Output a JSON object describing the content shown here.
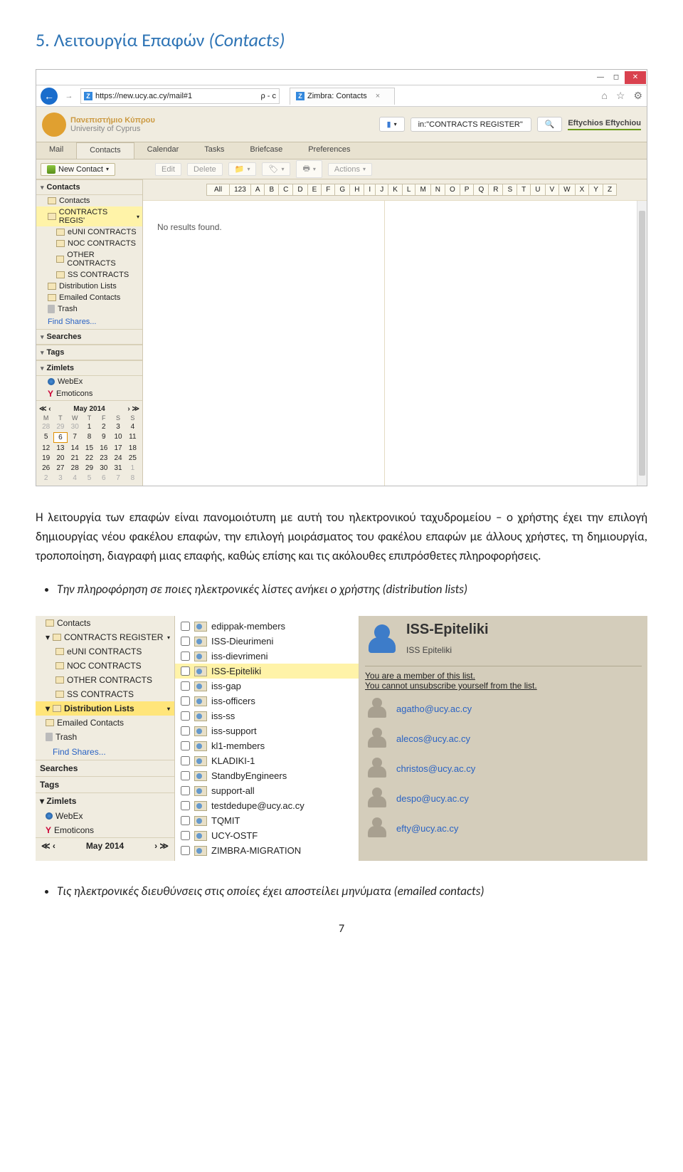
{
  "heading_num": "5.",
  "heading_main": "Λειτουργία Επαφών",
  "heading_paren": "(Contacts)",
  "para1": "Η λειτουργία των επαφών είναι πανομοιότυπη με αυτή του ηλεκτρονικού ταχυδρομείου – ο χρήστης έχει την επιλογή δημιουργίας νέου φακέλου επαφών, την επιλογή μοιράσματος του φακέλου επαφών με άλλους χρήστες, τη δημιουργία, τροποποίηση, διαγραφή μιας επαφής, καθώς επίσης και τις ακόλουθες επιπρόσθετες πληροφορήσεις.",
  "bullet1": "Την πληροφόρηση σε ποιες ηλεκτρονικές λίστες ανήκει ο χρήστης (distribution lists)",
  "bullet2": "Τις ηλεκτρονικές διευθύνσεις στις οποίες έχει αποστείλει μηνύματα (emailed contacts)",
  "pagenum": "7",
  "scr1": {
    "url": "https://new.ucy.ac.cy/mail#1",
    "url_suffix": "ρ - c",
    "tab_title": "Zimbra: Contacts",
    "search_text": "in:\"CONTRACTS REGISTER\"",
    "user": "Eftychios Eftychiou",
    "tabs": [
      "Mail",
      "Contacts",
      "Calendar",
      "Tasks",
      "Briefcase",
      "Preferences"
    ],
    "new_contact": "New Contact",
    "tb": {
      "edit": "Edit",
      "delete": "Delete",
      "actions": "Actions"
    },
    "sidebar": {
      "contacts": "Contacts",
      "items": [
        {
          "label": "Contacts"
        },
        {
          "label": "CONTRACTS REGIS'",
          "sel": true,
          "caret": true
        },
        {
          "label": "eUNI CONTRACTS",
          "indent": true
        },
        {
          "label": "NOC CONTRACTS",
          "indent": true
        },
        {
          "label": "OTHER CONTRACTS",
          "indent": true
        },
        {
          "label": "SS CONTRACTS",
          "indent": true
        },
        {
          "label": "Distribution Lists"
        },
        {
          "label": "Emailed Contacts"
        },
        {
          "label": "Trash",
          "trash": true
        }
      ],
      "find": "Find Shares...",
      "searches": "Searches",
      "tags": "Tags",
      "zimlets": "Zimlets",
      "webex": "WebEx",
      "emoticons": "Emoticons"
    },
    "cal": {
      "month": "May 2014",
      "dow": [
        "M",
        "T",
        "W",
        "T",
        "F",
        "S",
        "S"
      ],
      "weeks": [
        [
          {
            "d": "28",
            "off": true
          },
          {
            "d": "29",
            "off": true
          },
          {
            "d": "30",
            "off": true
          },
          {
            "d": "1"
          },
          {
            "d": "2"
          },
          {
            "d": "3"
          },
          {
            "d": "4"
          }
        ],
        [
          {
            "d": "5"
          },
          {
            "d": "6",
            "sel": true
          },
          {
            "d": "7"
          },
          {
            "d": "8"
          },
          {
            "d": "9"
          },
          {
            "d": "10"
          },
          {
            "d": "11"
          }
        ],
        [
          {
            "d": "12"
          },
          {
            "d": "13"
          },
          {
            "d": "14"
          },
          {
            "d": "15"
          },
          {
            "d": "16"
          },
          {
            "d": "17"
          },
          {
            "d": "18"
          }
        ],
        [
          {
            "d": "19"
          },
          {
            "d": "20"
          },
          {
            "d": "21"
          },
          {
            "d": "22"
          },
          {
            "d": "23"
          },
          {
            "d": "24"
          },
          {
            "d": "25"
          }
        ],
        [
          {
            "d": "26"
          },
          {
            "d": "27"
          },
          {
            "d": "28"
          },
          {
            "d": "29"
          },
          {
            "d": "30"
          },
          {
            "d": "31"
          },
          {
            "d": "1",
            "off": true
          }
        ],
        [
          {
            "d": "2",
            "off": true
          },
          {
            "d": "3",
            "off": true
          },
          {
            "d": "4",
            "off": true
          },
          {
            "d": "5",
            "off": true
          },
          {
            "d": "6",
            "off": true
          },
          {
            "d": "7",
            "off": true
          },
          {
            "d": "8",
            "off": true
          }
        ]
      ]
    },
    "alpha": [
      "All",
      "123",
      "A",
      "B",
      "C",
      "D",
      "E",
      "F",
      "G",
      "H",
      "I",
      "J",
      "K",
      "L",
      "M",
      "N",
      "O",
      "P",
      "Q",
      "R",
      "S",
      "T",
      "U",
      "V",
      "W",
      "X",
      "Y",
      "Z"
    ],
    "no_results": "No results found.",
    "logo1": "Πανεπιστήμιο Κύπρου",
    "logo2": "University of Cyprus"
  },
  "scr2": {
    "sidebar": {
      "items": [
        {
          "label": "Contacts"
        },
        {
          "label": "CONTRACTS REGISTER",
          "caret": true
        },
        {
          "label": "eUNI CONTRACTS",
          "indent": true
        },
        {
          "label": "NOC CONTRACTS",
          "indent": true
        },
        {
          "label": "OTHER CONTRACTS",
          "indent": true
        },
        {
          "label": "SS CONTRACTS",
          "indent": true
        },
        {
          "label": "Distribution Lists",
          "hl": true,
          "caret": true
        },
        {
          "label": "Emailed Contacts"
        },
        {
          "label": "Trash",
          "trash": true
        }
      ],
      "find": "Find Shares...",
      "searches": "Searches",
      "tags": "Tags",
      "zimlets": "Zimlets",
      "webex": "WebEx",
      "emoticons": "Emoticons",
      "month": "May 2014"
    },
    "lists": [
      "edippak-members",
      "ISS-Dieurimeni",
      "iss-dievrimeni",
      "ISS-Epiteliki",
      "iss-gap",
      "iss-officers",
      "iss-ss",
      "iss-support",
      "kl1-members",
      "KLADIKI-1",
      "StandbyEngineers",
      "support-all",
      "testdedupe@ucy.ac.cy",
      "TQMIT",
      "UCY-OSTF",
      "ZIMBRA-MIGRATION"
    ],
    "selected_index": 3,
    "detail": {
      "title": "ISS-Epiteliki",
      "sub": "ISS Epiteliki",
      "note1": "You are a member of this list.",
      "note2": "You cannot unsubscribe yourself from the list.",
      "members": [
        "agatho@ucy.ac.cy",
        "alecos@ucy.ac.cy",
        "christos@ucy.ac.cy",
        "despo@ucy.ac.cy",
        "efty@ucy.ac.cy"
      ]
    }
  }
}
